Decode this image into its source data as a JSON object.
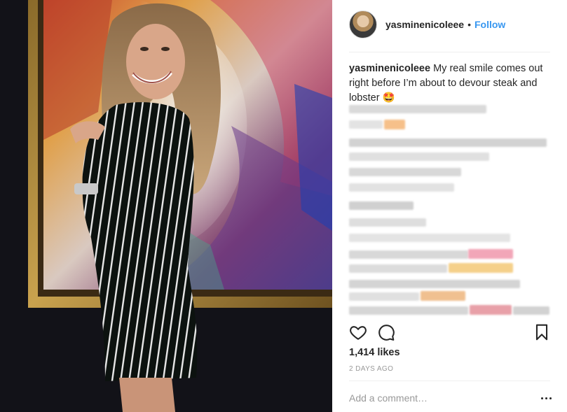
{
  "post": {
    "username": "yasminenicoleee",
    "separator": "•",
    "follow_label": "Follow",
    "caption_user": "yasminenicoleee",
    "caption_text": " My real smile comes out right before I’m about to devour steak and lobster 🤩",
    "likes": "1,414 likes",
    "time_ago": "2 DAYS AGO",
    "comment_placeholder": "Add a comment…"
  },
  "icons": {
    "like": "heart-icon",
    "comment": "comment-bubble-icon",
    "save": "bookmark-icon",
    "more": "ellipsis-icon"
  },
  "colors": {
    "accent": "#3897f0",
    "text": "#262626",
    "muted": "#999999",
    "divider": "#efefef"
  }
}
